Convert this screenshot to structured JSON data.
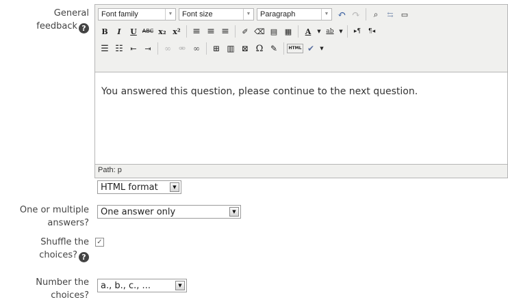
{
  "feedback": {
    "label_line1": "General",
    "label_line2": "feedback",
    "help_icon": "?",
    "toolbar": {
      "font_family": "Font family",
      "font_size": "Font size",
      "paragraph": "Paragraph",
      "html_label": "HTML"
    },
    "content_text": "You answered this question, please continue to the next question.",
    "path_label": "Path: p",
    "format_value": "HTML format"
  },
  "answers": {
    "label_line1": "One or multiple",
    "label_line2": "answers?",
    "value": "One answer only"
  },
  "shuffle": {
    "label_line1": "Shuffle the",
    "label_line2": "choices?",
    "help_icon": "?",
    "checked_mark": "✓"
  },
  "numbering": {
    "label_line1": "Number the",
    "label_line2": "choices?",
    "value": "a., b., c., ..."
  }
}
